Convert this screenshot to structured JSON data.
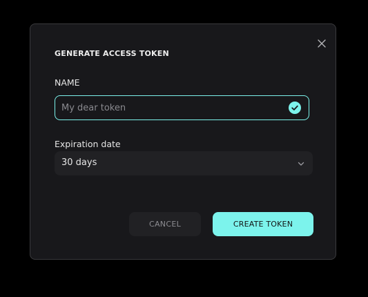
{
  "dialog": {
    "title": "GENERATE ACCESS TOKEN",
    "close_icon": "close-icon"
  },
  "name_field": {
    "label": "NAME",
    "placeholder": "My dear token",
    "value": "",
    "status_icon": "check-circle-icon",
    "accent_color": "#7cf3ec"
  },
  "expiration": {
    "label": "Expiration date",
    "selected": "30 days",
    "icon": "chevron-down-icon"
  },
  "actions": {
    "cancel_label": "CANCEL",
    "create_label": "CREATE TOKEN"
  },
  "colors": {
    "background": "#000000",
    "dialog_bg": "#18181b",
    "accent": "#7cf3ec",
    "field_bg": "#212124"
  }
}
